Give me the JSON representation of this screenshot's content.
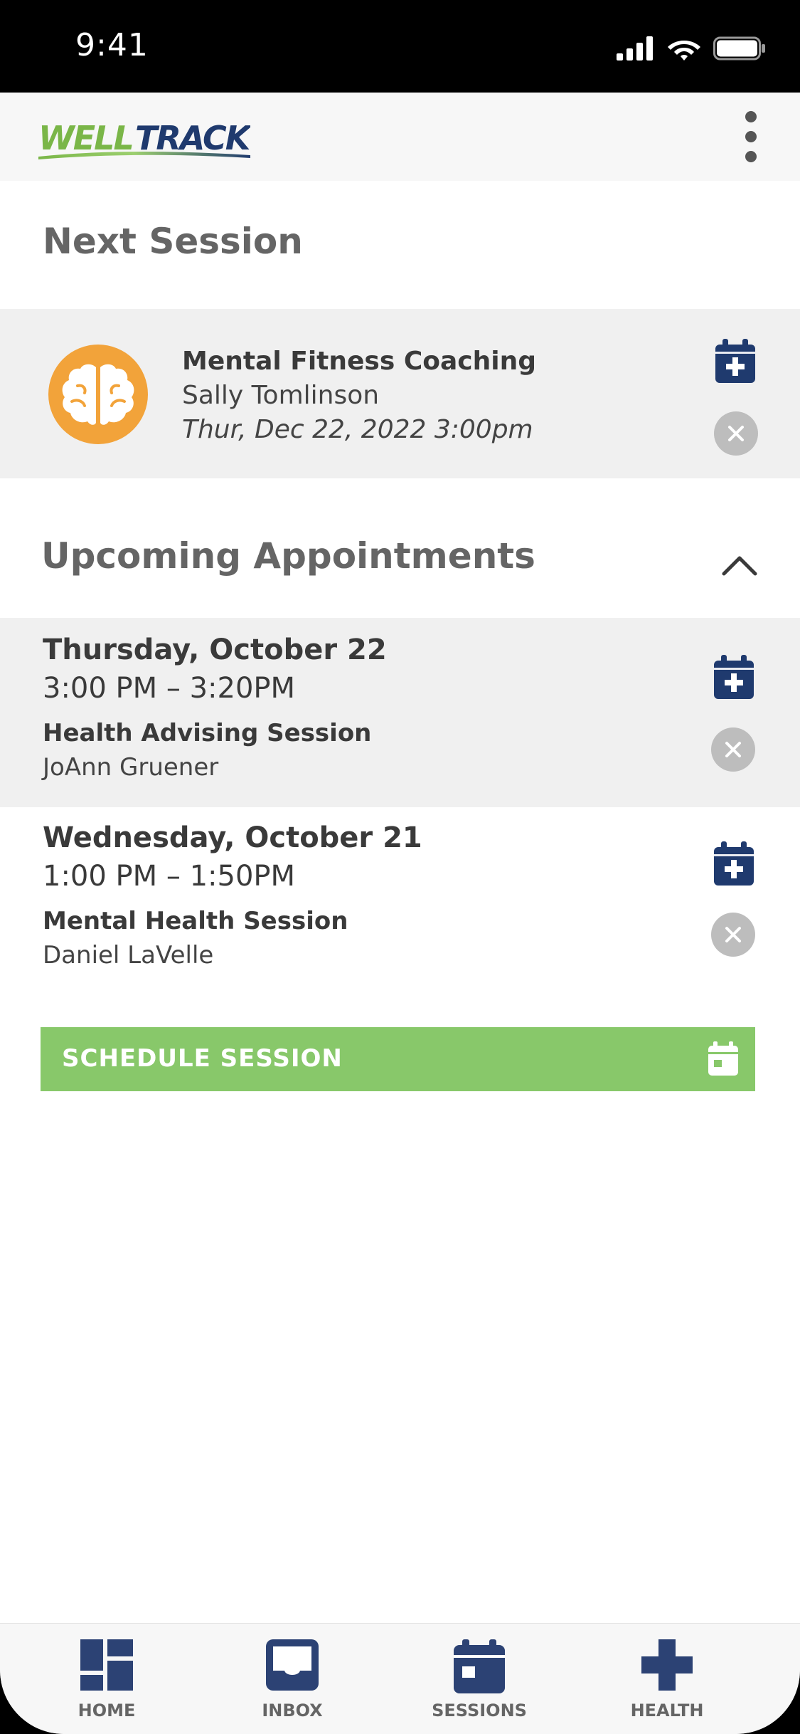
{
  "status": {
    "time": "9:41"
  },
  "header": {
    "logo_text_a": "WELL",
    "logo_text_b": "TRACK"
  },
  "next_session": {
    "title": "Next Session",
    "service": "Mental Fitness Coaching",
    "provider": "Sally Tomlinson",
    "datetime": "Thur, Dec 22, 2022 3:00pm"
  },
  "upcoming": {
    "title": "Upcoming Appointments",
    "items": [
      {
        "date": "Thursday, October 22",
        "time": "3:00 PM – 3:20PM",
        "type": "Health Advising Session",
        "provider": "JoAnn Gruener"
      },
      {
        "date": "Wednesday, October 21",
        "time": "1:00 PM – 1:50PM",
        "type": "Mental Health Session",
        "provider": "Daniel LaVelle"
      }
    ]
  },
  "schedule_button": {
    "label": "SCHEDULE SESSION"
  },
  "tabs": [
    {
      "label": "HOME",
      "icon": "dashboard-icon"
    },
    {
      "label": "INBOX",
      "icon": "inbox-icon"
    },
    {
      "label": "SESSIONS",
      "icon": "calendar-icon"
    },
    {
      "label": "HEALTH",
      "icon": "health-cross-icon"
    }
  ],
  "colors": {
    "brand_navy": "#1f3a6e",
    "brand_green": "#88c86a",
    "accent_orange": "#f2a33a",
    "text_gray": "#656565"
  }
}
